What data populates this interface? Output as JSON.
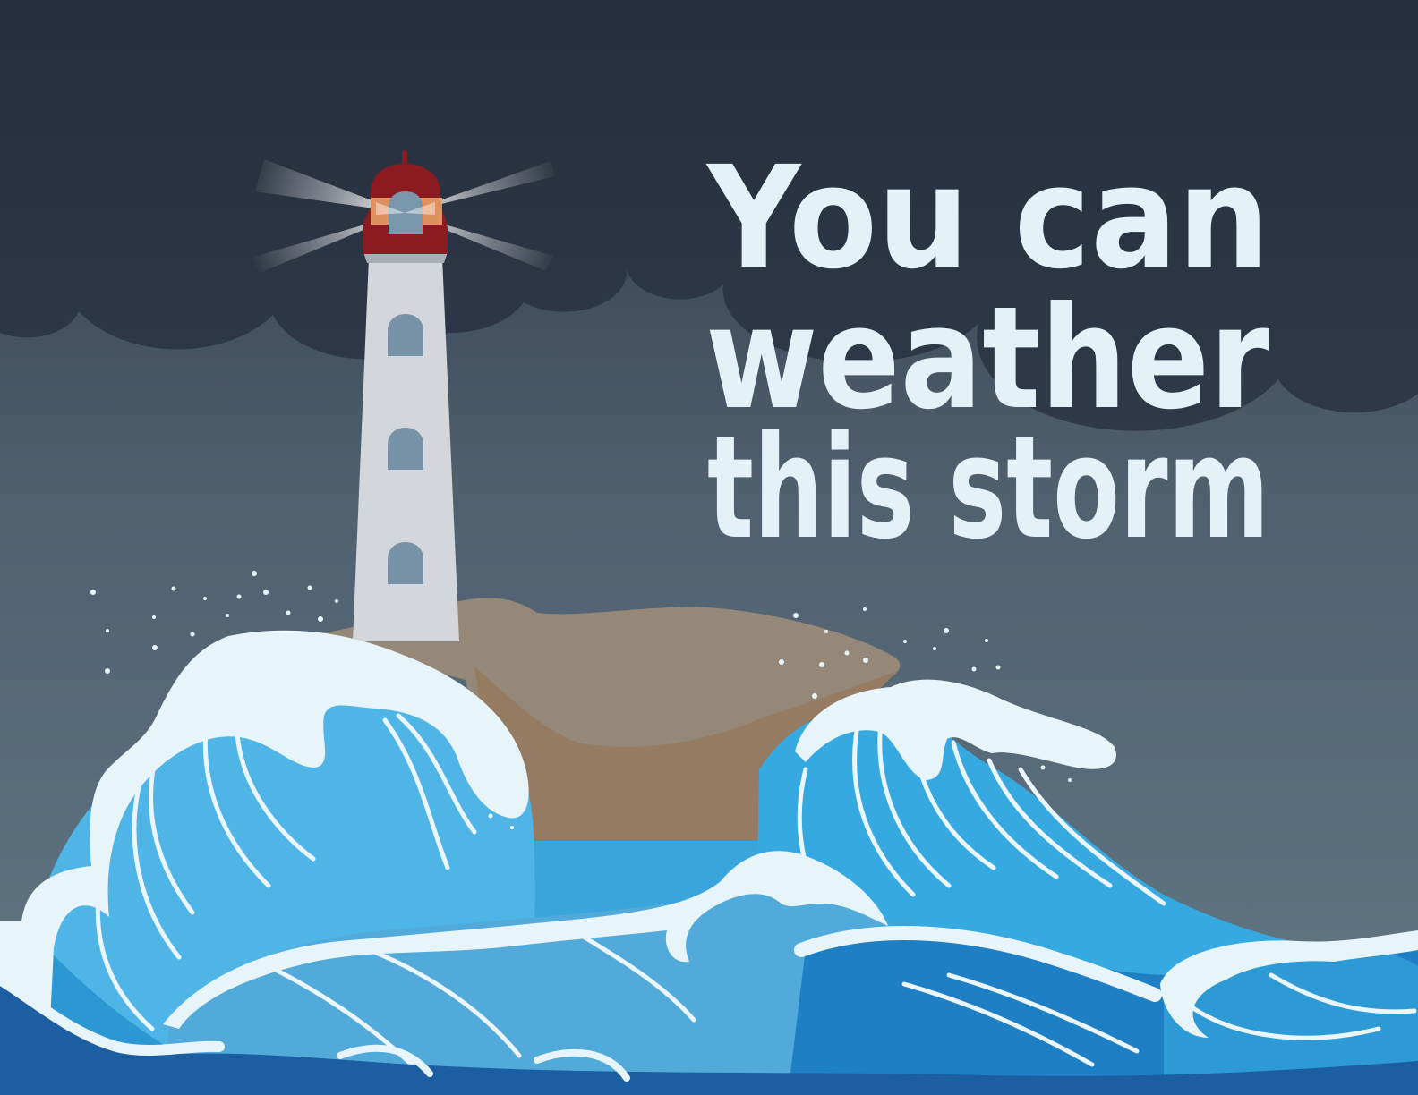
{
  "headline": {
    "line1": "You can",
    "line2": "weather",
    "line3": "this storm"
  },
  "colors": {
    "headline_text": "#e4f2f8",
    "cloud": "#283040",
    "lamp_housing": "#8b1b20",
    "lamp_window": "#7996ab",
    "tower": "#d3d6da",
    "tower_window": "#7893a8",
    "rock": "#958879",
    "rock_shadow": "#957b62",
    "wave_light": "#4fb5e7",
    "wave_mid": "#36aae0",
    "wave_front": "#51aad9",
    "deep_sea": "#1f7fc4",
    "dark_sea": "#1c5ea2",
    "foam": "#e7f4fa"
  }
}
